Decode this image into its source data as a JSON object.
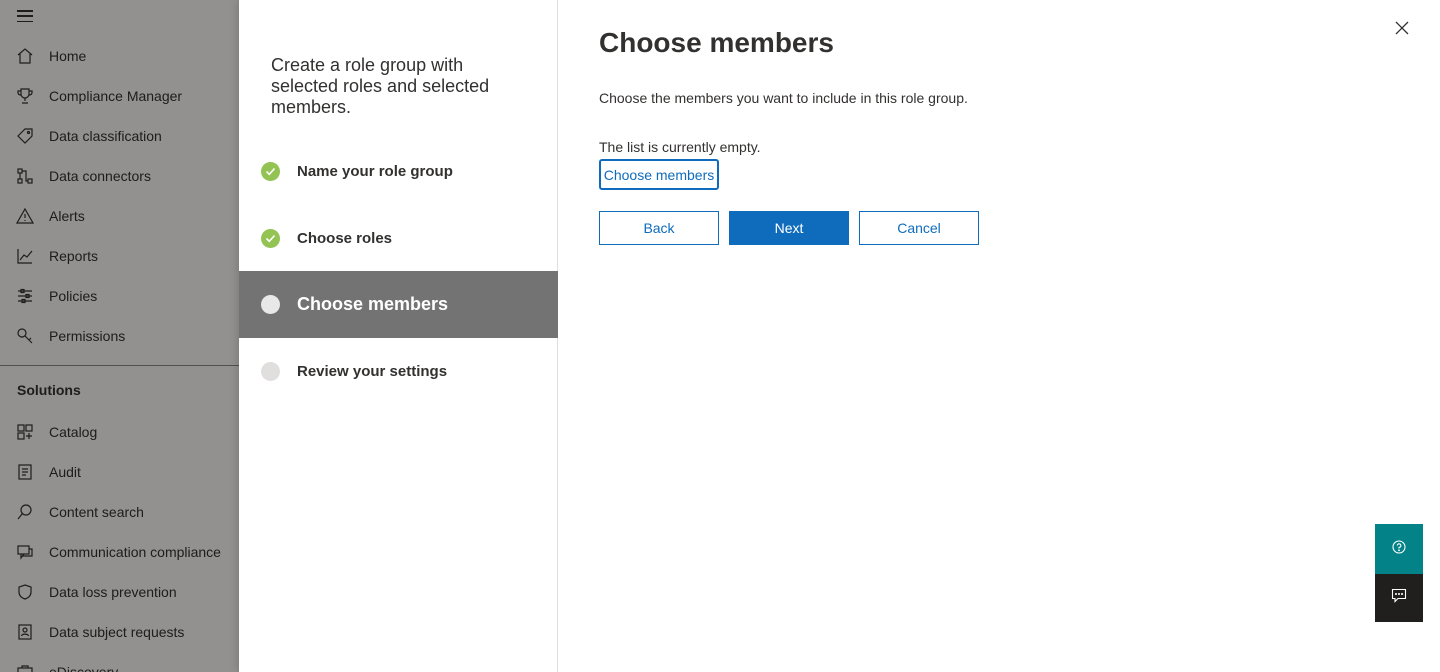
{
  "nav": {
    "items": [
      {
        "label": "Home",
        "icon": "home-icon"
      },
      {
        "label": "Compliance Manager",
        "icon": "trophy-icon"
      },
      {
        "label": "Data classification",
        "icon": "tag-icon"
      },
      {
        "label": "Data connectors",
        "icon": "connector-icon"
      },
      {
        "label": "Alerts",
        "icon": "alert-icon"
      },
      {
        "label": "Reports",
        "icon": "chart-icon"
      },
      {
        "label": "Policies",
        "icon": "sliders-icon"
      },
      {
        "label": "Permissions",
        "icon": "key-icon"
      }
    ],
    "section_label": "Solutions",
    "solutions": [
      {
        "label": "Catalog",
        "icon": "catalog-icon"
      },
      {
        "label": "Audit",
        "icon": "audit-icon"
      },
      {
        "label": "Content search",
        "icon": "search-icon"
      },
      {
        "label": "Communication compliance",
        "icon": "chat-icon"
      },
      {
        "label": "Data loss prevention",
        "icon": "shield-icon"
      },
      {
        "label": "Data subject requests",
        "icon": "person-doc-icon"
      },
      {
        "label": "eDiscovery",
        "icon": "briefcase-icon"
      }
    ]
  },
  "wizard": {
    "title": "Create a role group with selected roles and selected members.",
    "steps": [
      {
        "label": "Name your role group",
        "state": "done"
      },
      {
        "label": "Choose roles",
        "state": "done"
      },
      {
        "label": "Choose members",
        "state": "current"
      },
      {
        "label": "Review your settings",
        "state": "pending"
      }
    ]
  },
  "main": {
    "heading": "Choose members",
    "description": "Choose the members you want to include in this role group.",
    "empty_text": "The list is currently empty.",
    "choose_members_label": "Choose members",
    "back_label": "Back",
    "next_label": "Next",
    "cancel_label": "Cancel"
  },
  "colors": {
    "accent": "#0f6cbd",
    "step_done": "#92c353",
    "step_current_bg": "#737373",
    "help_fab": "#038387",
    "feedback_fab": "#201f1e"
  }
}
